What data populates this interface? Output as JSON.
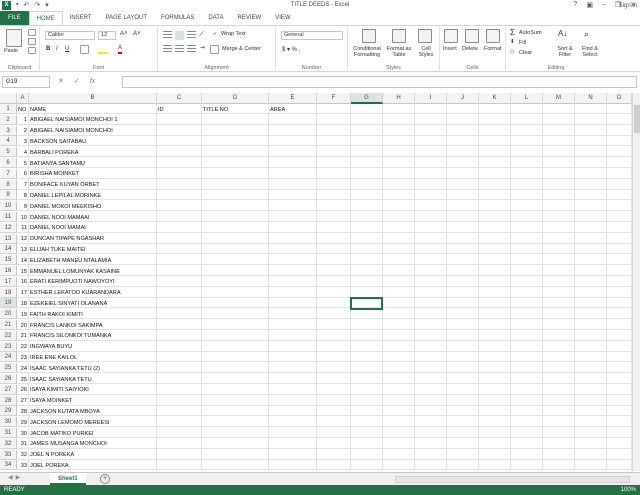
{
  "window": {
    "title": "TITLE DEEDS - Excel",
    "signin": "Sign in"
  },
  "tabs": [
    "FILE",
    "HOME",
    "INSERT",
    "PAGE LAYOUT",
    "FORMULAS",
    "DATA",
    "REVIEW",
    "VIEW"
  ],
  "ribbon": {
    "clipboard": {
      "paste": "Paste",
      "label": "Clipboard"
    },
    "font": {
      "name": "Calibri",
      "size": "12",
      "label": "Font"
    },
    "alignment": {
      "wrap": "Wrap Text",
      "merge": "Merge & Center",
      "label": "Alignment"
    },
    "number": {
      "format": "General",
      "symbols": "$ ▾ % ,",
      "label": "Number"
    },
    "styles": {
      "conditional": "Conditional Formatting",
      "format_table": "Format as Table",
      "cell_styles": "Cell Styles",
      "label": "Styles"
    },
    "cells": {
      "insert": "Insert",
      "delete": "Delete",
      "format": "Format",
      "label": "Cells"
    },
    "editing": {
      "autosum": "AutoSum",
      "fill": "Fill",
      "clear": "Clear",
      "sort": "Sort & Filter",
      "find": "Find & Select",
      "label": "Editing"
    }
  },
  "formula_bar": {
    "name_box": "G19",
    "fx": "fx",
    "value": ""
  },
  "columns": [
    "A",
    "B",
    "C",
    "D",
    "E",
    "F",
    "G",
    "H",
    "I",
    "J",
    "K",
    "L",
    "M",
    "N",
    "O"
  ],
  "selected_column": "G",
  "selected_row": 19,
  "headers": {
    "no": "NO",
    "name": "NAME",
    "id": "ID",
    "title_no": "TITLE NO",
    "area": "AREA"
  },
  "rows": [
    {
      "no": "1",
      "name": "ABIGAEL NAISIAMOI MONCHOI 1"
    },
    {
      "no": "2",
      "name": "ABIGAEL NAISIAMOI MONCHOI"
    },
    {
      "no": "3",
      "name": "BACKSON SAITABAU"
    },
    {
      "no": "4",
      "name": "BARBALI POREKA"
    },
    {
      "no": "5",
      "name": "BATIANYA SANTAMU"
    },
    {
      "no": "6",
      "name": "BIRISHA MOINKET"
    },
    {
      "no": "7",
      "name": "BONIFACE KUYAN ORBET"
    },
    {
      "no": "8",
      "name": "DANIEL LEPILAL MORINKE"
    },
    {
      "no": "9",
      "name": "DANIEL MOKOI MEEKISHO"
    },
    {
      "no": "10",
      "name": "DANIEL NOOI MAMAAI"
    },
    {
      "no": "11",
      "name": "DANIEL NOOI MAMAI"
    },
    {
      "no": "12",
      "name": "DUNCAN TIPAPE NGASHAR"
    },
    {
      "no": "13",
      "name": "ELIJAH TUKE MAITEI"
    },
    {
      "no": "14",
      "name": "ELIZABETH MANEU NTALAMIA"
    },
    {
      "no": "15",
      "name": "EMMANUEL LOMUNYAK KASAINE"
    },
    {
      "no": "16",
      "name": "ERATI KERIMPUOTI NAWOYOYI"
    },
    {
      "no": "17",
      "name": "ESTHER LEKATOO KUARANDARA"
    },
    {
      "no": "18",
      "name": "EZEKEIEL SINYATI OLANANA"
    },
    {
      "no": "19",
      "name": "FAITH RAKOI KIMITI"
    },
    {
      "no": "20",
      "name": "FRANCIS LANKOI SAKIMPA"
    },
    {
      "no": "21",
      "name": "FRANCIS SILONKOI TUMANKA"
    },
    {
      "no": "22",
      "name": "INGWAYA BUYU"
    },
    {
      "no": "23",
      "name": "IREE ENE KAILOL"
    },
    {
      "no": "24",
      "name": "ISAAC SAYIANKA TETU (2)"
    },
    {
      "no": "25",
      "name": "ISAAC SAYIANKA TETU"
    },
    {
      "no": "26",
      "name": "ISAYA KIMITI SAIYIOKI"
    },
    {
      "no": "27",
      "name": "ISAYA MOINKET"
    },
    {
      "no": "28",
      "name": "JACKSON KUTATA MBOYA"
    },
    {
      "no": "29",
      "name": "JACKSON LEMOMO MEREESI"
    },
    {
      "no": "30",
      "name": "JACOB MATIKO PURKEI"
    },
    {
      "no": "31",
      "name": "JAMES MUSANGA MONCHOI"
    },
    {
      "no": "32",
      "name": "JOEL N POREKA"
    },
    {
      "no": "33",
      "name": "JOEL POREKA"
    },
    {
      "no": "34",
      "name": "JOHN MAIYANI TETU"
    }
  ],
  "sheet_tabs": [
    "Sheet1"
  ],
  "status": {
    "ready": "READY",
    "zoom": "100%"
  }
}
